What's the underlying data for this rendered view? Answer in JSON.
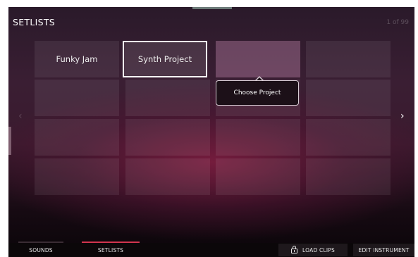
{
  "header": {
    "title": "SETLISTS",
    "page_count": "1 of 99"
  },
  "grid": {
    "rows": [
      [
        {
          "label": "Funky Jam",
          "state": "normal"
        },
        {
          "label": "Synth Project",
          "state": "selected"
        },
        {
          "label": "",
          "state": "highlight"
        },
        {
          "label": "",
          "state": "empty"
        }
      ],
      [
        {
          "label": "",
          "state": "empty"
        },
        {
          "label": "",
          "state": "empty"
        },
        {
          "label": "",
          "state": "empty"
        },
        {
          "label": "",
          "state": "empty"
        }
      ],
      [
        {
          "label": "",
          "state": "empty"
        },
        {
          "label": "",
          "state": "empty"
        },
        {
          "label": "",
          "state": "empty"
        },
        {
          "label": "",
          "state": "empty"
        }
      ],
      [
        {
          "label": "",
          "state": "empty"
        },
        {
          "label": "",
          "state": "empty"
        },
        {
          "label": "",
          "state": "empty"
        },
        {
          "label": "",
          "state": "empty"
        }
      ]
    ]
  },
  "tooltip": {
    "text": "Choose Project"
  },
  "nav": {
    "prev_icon": "chevron-left-icon",
    "next_icon": "chevron-right-icon",
    "prev_glyph": "‹",
    "next_glyph": "›"
  },
  "bottom_bar": {
    "tabs": [
      {
        "label": "SOUNDS"
      },
      {
        "label": "SETLISTS",
        "active": true
      }
    ],
    "actions": [
      {
        "label": "LOAD CLIPS",
        "icon": "lock-icon"
      },
      {
        "label": "EDIT INSTRUMENT"
      }
    ]
  },
  "colors": {
    "active_tab_accent": "#d2354f",
    "selected_border": "#ffffff",
    "highlight_cell": "#c88cb4"
  }
}
